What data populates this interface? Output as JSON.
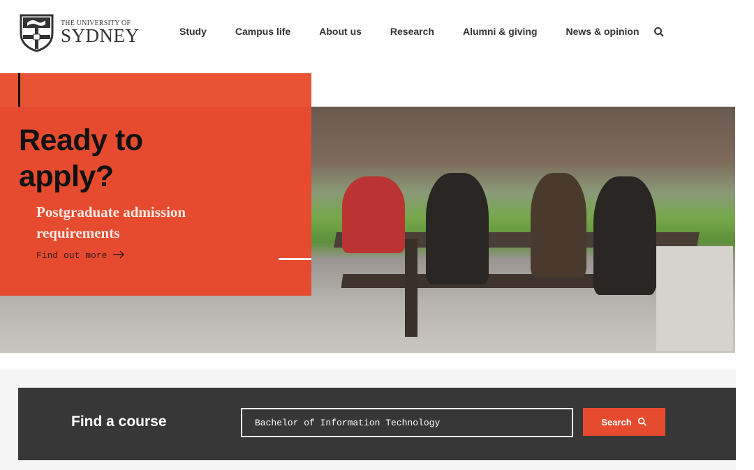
{
  "header": {
    "logo": {
      "small": "THE UNIVERSITY OF",
      "big": "SYDNEY"
    },
    "nav": [
      "Study",
      "Campus life",
      "About us",
      "Research",
      "Alumni & giving",
      "News & opinion"
    ],
    "search_icon": "search-icon"
  },
  "hero": {
    "title_line1": "Ready to",
    "title_line2": "apply?",
    "subtitle_line1": "Postgraduate admission",
    "subtitle_line2": "requirements",
    "link": "Find out more",
    "link_icon": "arrow-right-icon",
    "accent": "#e64b2f"
  },
  "find_course": {
    "title": "Find a course",
    "input_value": "Bachelor of Information Technology",
    "button": "Search",
    "bg": "#373737"
  }
}
